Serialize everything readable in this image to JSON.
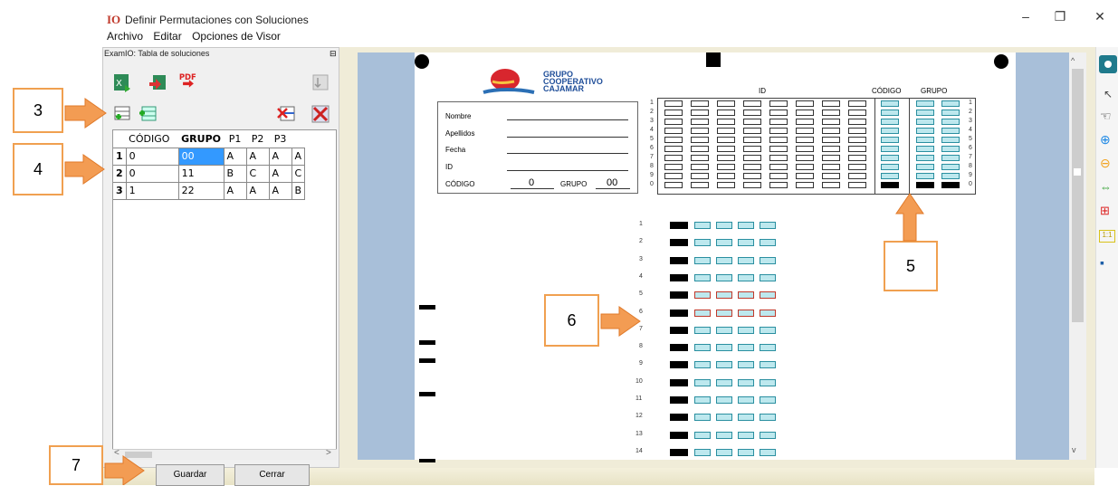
{
  "window": {
    "logo_text": "IO",
    "title": "Definir Permutaciones con Soluciones",
    "controls": [
      "–",
      "❐",
      "✕"
    ]
  },
  "menu": [
    "Archivo",
    "Editar",
    "Opciones de Visor"
  ],
  "panel": {
    "title": "ExamIO: Tabla de soluciones",
    "pin_icon": "pin-icon",
    "columns": [
      "CÓDIGO",
      "GRUPO",
      "P1",
      "P2",
      "P3"
    ],
    "rows": [
      {
        "num": "1",
        "cells": [
          "0",
          "00",
          "A",
          "A",
          "A",
          "A"
        ]
      },
      {
        "num": "2",
        "cells": [
          "0",
          "11",
          "B",
          "C",
          "A",
          "C"
        ]
      },
      {
        "num": "3",
        "cells": [
          "1",
          "22",
          "A",
          "A",
          "A",
          "B"
        ]
      }
    ],
    "save_label": "Guardar",
    "close_label": "Cerrar"
  },
  "callouts": [
    "3",
    "4",
    "5",
    "6",
    "7"
  ],
  "sheet": {
    "brand_lines": [
      "GRUPO",
      "COOPERATIVO",
      "CAJAMAR"
    ],
    "fields": [
      "Nombre",
      "Apellidos",
      "Fecha",
      "ID"
    ],
    "codigo_label": "CÓDIGO",
    "codigo_value": "0",
    "grupo_label": "GRUPO",
    "grupo_value": "00",
    "header_id": "ID",
    "header_codigo": "CÓDIGO",
    "header_grupo": "GRUPO",
    "digits": [
      "1",
      "2",
      "3",
      "4",
      "5",
      "6",
      "7",
      "8",
      "9",
      "0"
    ],
    "questions": [
      "1",
      "2",
      "3",
      "4",
      "5",
      "6",
      "7",
      "8",
      "9",
      "10",
      "11",
      "12",
      "13",
      "14"
    ]
  },
  "colors": {
    "callout_border": "#f0a050",
    "bubble_fill": "#bde8ee",
    "sheet_bg": "#a8bfd9"
  }
}
